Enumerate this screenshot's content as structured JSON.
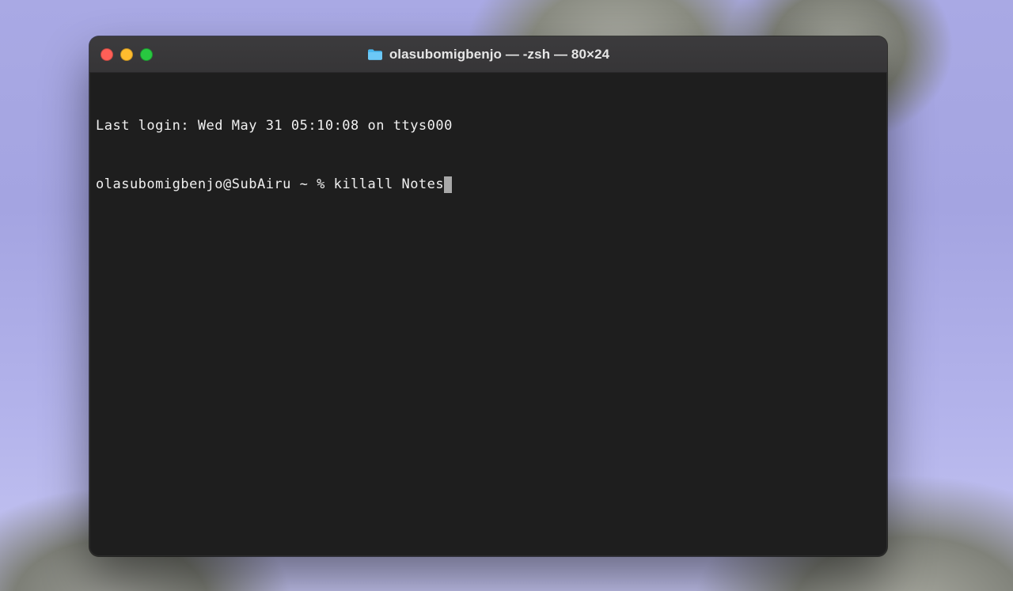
{
  "window": {
    "title": "olasubomigbenjo — -zsh — 80×24"
  },
  "terminal": {
    "last_login": "Last login: Wed May 31 05:10:08 on ttys000",
    "prompt": "olasubomigbenjo@SubAiru ~ % ",
    "command": "killall Notes"
  }
}
